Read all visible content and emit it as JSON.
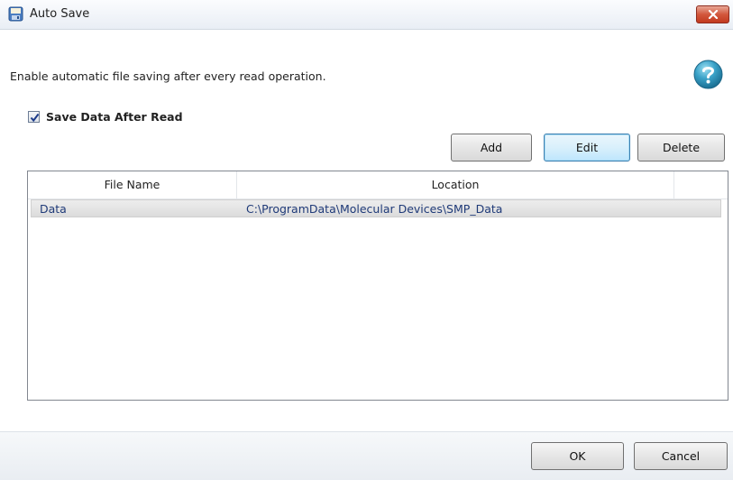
{
  "window": {
    "title": "Auto Save"
  },
  "description": "Enable automatic file saving after every read operation.",
  "save_after_read": {
    "label": "Save Data After Read",
    "checked": true
  },
  "toolbar": {
    "add_label": "Add",
    "edit_label": "Edit",
    "delete_label": "Delete"
  },
  "table": {
    "columns": [
      "File Name",
      "Location"
    ],
    "rows": [
      {
        "file_name": "Data",
        "location": "C:\\ProgramData\\Molecular Devices\\SMP_Data"
      }
    ]
  },
  "footer": {
    "ok_label": "OK",
    "cancel_label": "Cancel"
  },
  "icons": {
    "title": "save-disk-icon",
    "help": "help-icon",
    "close": "close-icon"
  },
  "colors": {
    "close_button": "#c9472c",
    "help_circle": "#2a8fb8",
    "link_text": "#1f3a78"
  }
}
